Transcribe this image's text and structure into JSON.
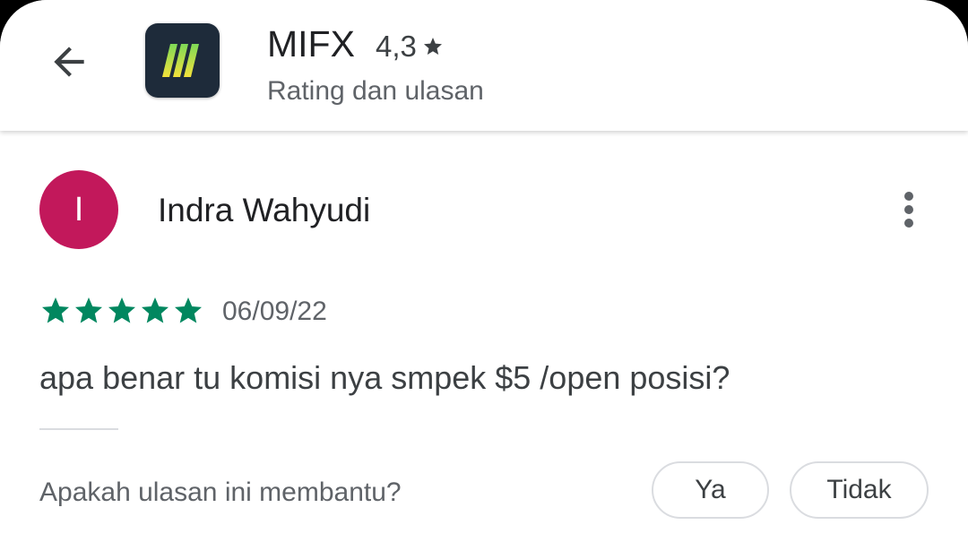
{
  "header": {
    "back_icon": "arrow-back-icon",
    "app_icon": "mifx-logo-icon",
    "app_name": "MIFX",
    "rating": "4,3",
    "rating_icon": "star-icon",
    "subtitle": "Rating dan ulasan"
  },
  "review": {
    "avatar_initial": "I",
    "avatar_color": "#c2185b",
    "reviewer_name": "Indra Wahyudi",
    "more_icon": "more-vert-icon",
    "stars": 5,
    "star_color": "#01875f",
    "date": "06/09/22",
    "text": "apa benar tu komisi nya smpek $5 /open posisi?"
  },
  "helpful": {
    "question": "Apakah ulasan ini membantu?",
    "yes_label": "Ya",
    "no_label": "Tidak"
  }
}
